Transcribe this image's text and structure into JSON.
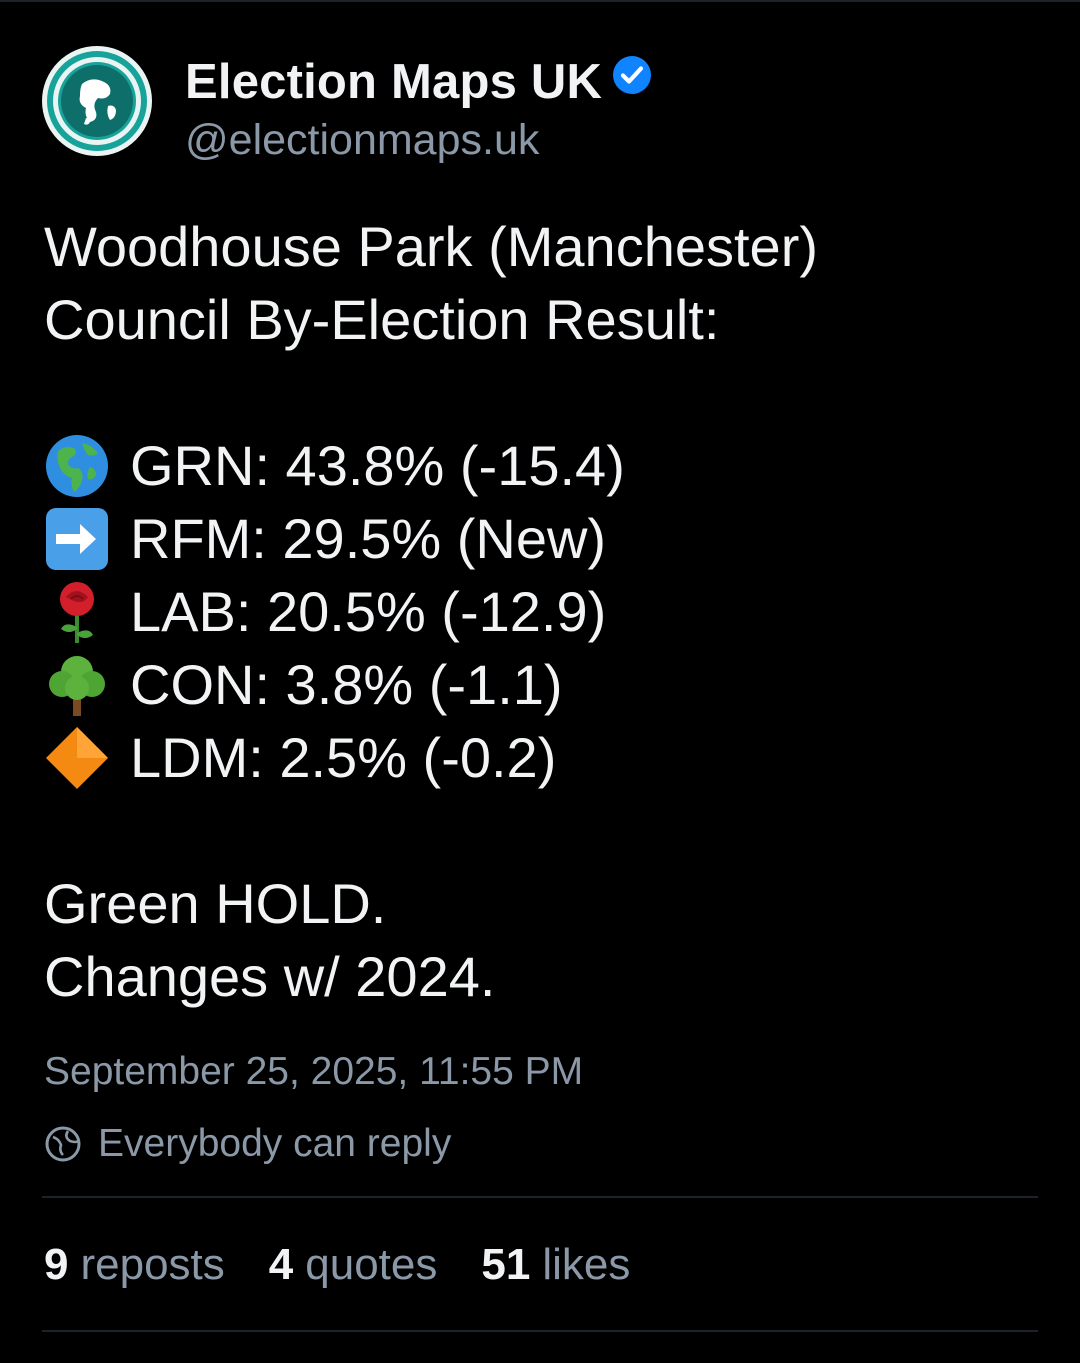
{
  "author": {
    "display_name": "Election Maps UK",
    "handle": "@electionmaps.uk",
    "verified": true,
    "avatar_icon": "globe-logo-icon"
  },
  "post": {
    "title_line1": "Woodhouse Park (Manchester)",
    "title_line2": "Council By-Election Result:",
    "results": [
      {
        "emoji": "globe-emoji",
        "text": "GRN: 43.8% (-15.4)"
      },
      {
        "emoji": "right-arrow-emoji",
        "text": "RFM: 29.5% (New)"
      },
      {
        "emoji": "rose-emoji",
        "text": "LAB: 20.5% (-12.9)"
      },
      {
        "emoji": "tree-emoji",
        "text": "CON: 3.8% (-1.1)"
      },
      {
        "emoji": "orange-diamond-emoji",
        "text": "LDM: 2.5% (-0.2)"
      }
    ],
    "footer_line1": "Green HOLD.",
    "footer_line2": "Changes w/ 2024."
  },
  "meta": {
    "timestamp": "September 25, 2025, 11:55 PM",
    "reply_setting": "Everybody can reply"
  },
  "stats": {
    "reposts_count": "9",
    "reposts_label": "reposts",
    "quotes_count": "4",
    "quotes_label": "quotes",
    "likes_count": "51",
    "likes_label": "likes"
  },
  "colors": {
    "background": "#000000",
    "text_primary": "#f1f3f5",
    "text_secondary": "#8b98a7",
    "verified_blue": "#1083fe",
    "divider": "#1e2329"
  }
}
